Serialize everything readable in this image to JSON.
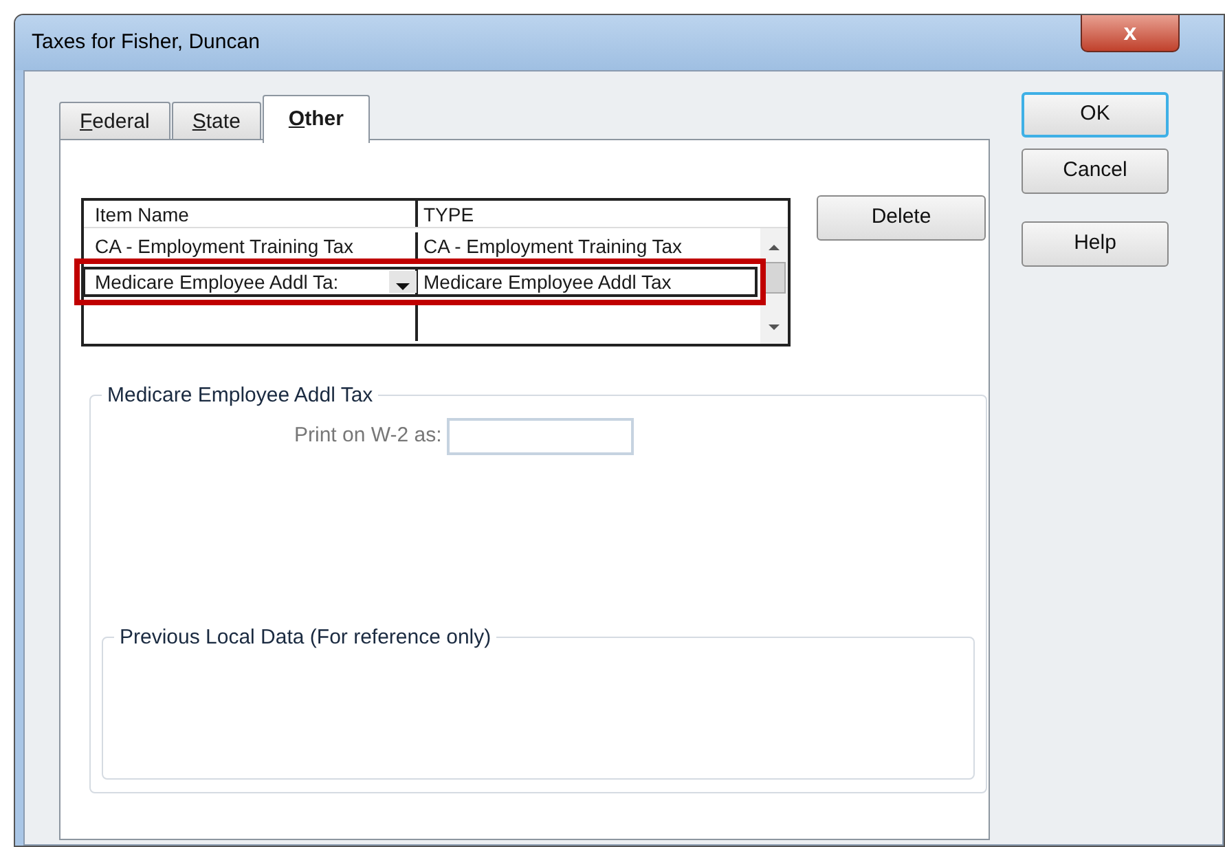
{
  "window": {
    "title": "Taxes for Fisher, Duncan",
    "close_label": "x"
  },
  "tabs": [
    {
      "label": "Federal",
      "selected": false,
      "underline_first": true
    },
    {
      "label": "State",
      "selected": false,
      "underline_first": true
    },
    {
      "label": "Other",
      "selected": true,
      "underline_first": true
    }
  ],
  "table": {
    "columns": [
      "Item Name",
      "TYPE"
    ],
    "rows": [
      {
        "cells": [
          "CA - Employment Training Tax",
          "CA - Employment Training Tax"
        ],
        "selected": false
      },
      {
        "cells": [
          "Medicare Employee Addl Ta:",
          "Medicare Employee Addl Tax"
        ],
        "selected": true
      }
    ]
  },
  "delete_button": "Delete",
  "buttons": [
    {
      "label": "OK",
      "default": true
    },
    {
      "label": "Cancel",
      "default": false
    },
    {
      "label": "Help",
      "default": false
    }
  ],
  "group": {
    "title": "Medicare Employee Addl Tax",
    "field_label": "Print on W-2 as:",
    "field_disabled": true
  },
  "previous_group": {
    "title": "Previous Local Data (For reference only)"
  }
}
